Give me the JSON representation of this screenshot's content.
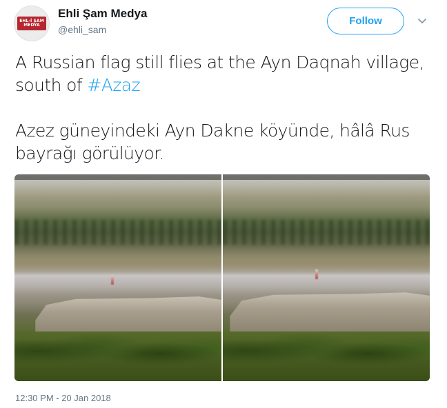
{
  "author": {
    "name": "Ehli Şam Medya",
    "handle": "@ehli_sam",
    "avatar_text_line1": "EHL-İ ŞAM",
    "avatar_text_line2": "MEDYA"
  },
  "actions": {
    "follow_label": "Follow"
  },
  "tweet": {
    "line1_text": "A Russian flag still flies at the Ayn Daqnah village, south of ",
    "hashtag": "#Azaz",
    "line2_text": "Azez güneyindeki Ayn Dakne köyünde, hâlâ Rus bayrağı görülüyor."
  },
  "media": {
    "photo_count": 2
  },
  "meta": {
    "timestamp": "12:30 PM - 20 Jan 2018"
  },
  "colors": {
    "accent": "#1da1f2",
    "text": "#14171a",
    "secondary": "#657786"
  }
}
